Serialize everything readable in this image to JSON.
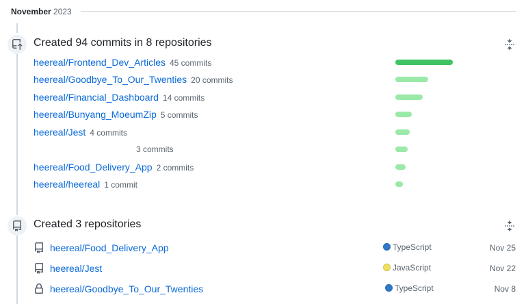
{
  "month": {
    "label": "November",
    "year": "2023"
  },
  "commits_section": {
    "title": "Created 94 commits in 8 repositories",
    "max_commits": 45,
    "rows": [
      {
        "repo": "heereal/Frontend_Dev_Articles",
        "count_label": "45 commits",
        "commits": 45
      },
      {
        "repo": "heereal/Goodbye_To_Our_Twenties",
        "count_label": "20 commits",
        "commits": 20
      },
      {
        "repo": "heereal/Financial_Dashboard",
        "count_label": "14 commits",
        "commits": 14
      },
      {
        "repo": "heereal/Bunyang_MoeumZip",
        "count_label": "5 commits",
        "commits": 5
      },
      {
        "repo": "heereal/Jest",
        "count_label": "4 commits",
        "commits": 4
      },
      {
        "repo": "",
        "count_label": "3 commits",
        "commits": 3
      },
      {
        "repo": "heereal/Food_Delivery_App",
        "count_label": "2 commits",
        "commits": 2
      },
      {
        "repo": "heereal/heereal",
        "count_label": "1 commit",
        "commits": 1
      }
    ]
  },
  "repos_section": {
    "title": "Created 3 repositories",
    "rows": [
      {
        "repo": "heereal/Food_Delivery_App",
        "icon": "repo-icon",
        "language": "TypeScript",
        "language_color": "#3178c6",
        "date": "Nov 25"
      },
      {
        "repo": "heereal/Jest",
        "icon": "repo-icon",
        "language": "JavaScript",
        "language_color": "#f1e05a",
        "date": "Nov 22"
      },
      {
        "repo": "heereal/Goodbye_To_Our_Twenties",
        "icon": "lock-icon",
        "language": "TypeScript",
        "language_color": "#3178c6",
        "date": "Nov 8"
      }
    ]
  },
  "colors": {
    "bar_strong": "#40c463",
    "bar_light": "#9be9a8",
    "link": "#0969da"
  }
}
